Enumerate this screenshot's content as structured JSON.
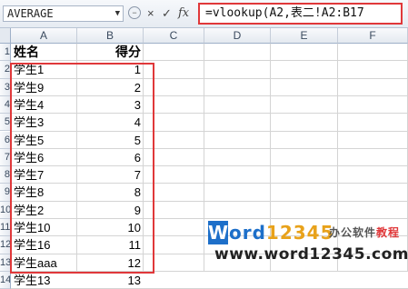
{
  "formula_bar": {
    "name_box": "AVERAGE",
    "cancel_icon": "×",
    "enter_icon": "✓",
    "fx_label": "fx",
    "formula": "=vlookup(A2,表二!A2:B17"
  },
  "columns": [
    "A",
    "B",
    "C",
    "D",
    "E",
    "F"
  ],
  "row_numbers": [
    "1",
    "2",
    "3",
    "4",
    "5",
    "6",
    "7",
    "8",
    "9",
    "10",
    "11",
    "12",
    "13",
    "14"
  ],
  "header": {
    "name": "姓名",
    "score": "得分"
  },
  "rows": [
    {
      "name": "学生1",
      "score": "1"
    },
    {
      "name": "学生9",
      "score": "2"
    },
    {
      "name": "学生4",
      "score": "3"
    },
    {
      "name": "学生3",
      "score": "4"
    },
    {
      "name": "学生5",
      "score": "5"
    },
    {
      "name": "学生6",
      "score": "6"
    },
    {
      "name": "学生7",
      "score": "7"
    },
    {
      "name": "学生8",
      "score": "8"
    },
    {
      "name": "学生2",
      "score": "9"
    },
    {
      "name": "学生10",
      "score": "10"
    },
    {
      "name": "学生16",
      "score": "11"
    },
    {
      "name": "学生aaa",
      "score": "12"
    },
    {
      "name": "学生13",
      "score": "13"
    }
  ],
  "watermark": {
    "logo_letter": "W",
    "logo_text_a": "ord",
    "logo_text_b": "12345",
    "subtitle_a": "办公软件",
    "subtitle_b": "教程",
    "url": "www.word12345.com"
  },
  "colors": {
    "highlight_red": "#e0383a",
    "brand_blue": "#1d6fc9",
    "brand_orange": "#e8a21b"
  }
}
